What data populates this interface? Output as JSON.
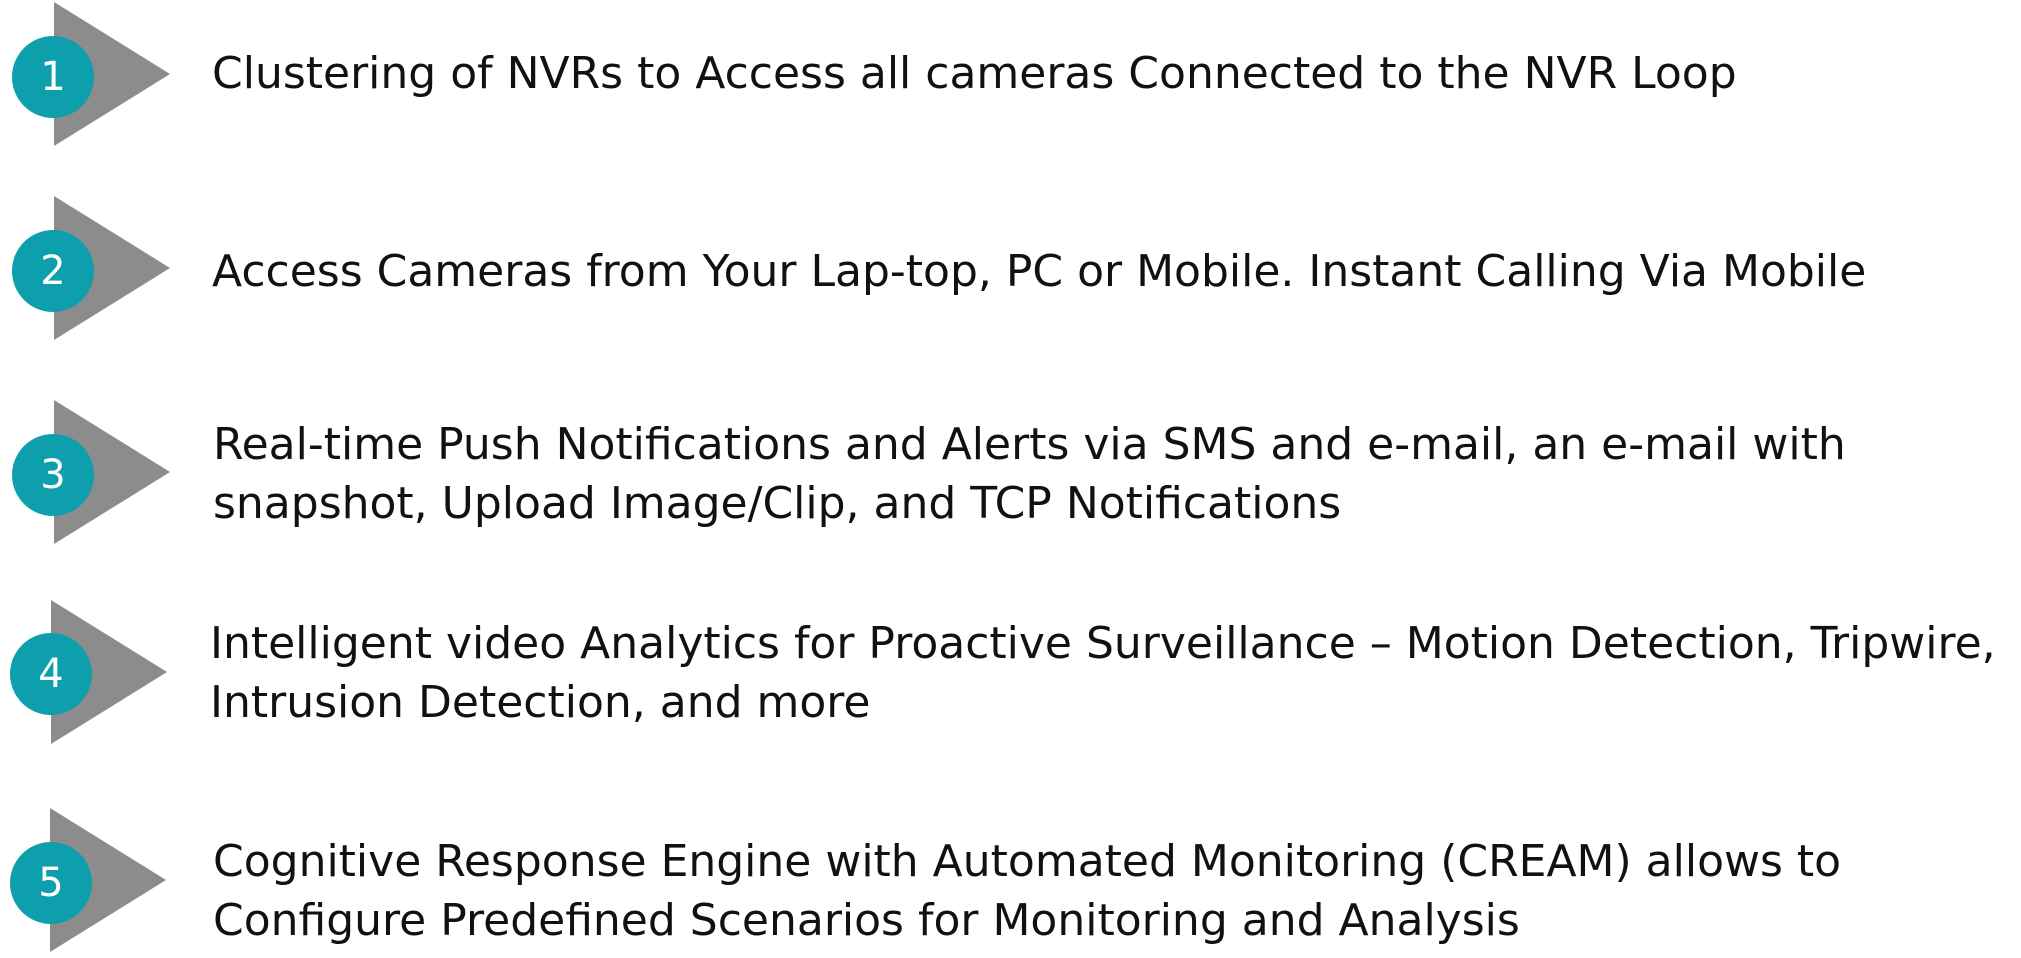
{
  "colors": {
    "circle": "#0e9fad",
    "triangle": "#8c8c8c",
    "text": "#111111",
    "number": "#ffffff"
  },
  "icons": {
    "triangle": "play-triangle-icon",
    "circle": "numbered-circle-badge"
  },
  "items": [
    {
      "number": "1",
      "lines": [
        "Clustering of NVRs to Access all cameras Connected to the NVR Loop"
      ]
    },
    {
      "number": "2",
      "lines": [
        "Access Cameras from Your Lap-top, PC or Mobile. Instant Calling Via Mobile"
      ]
    },
    {
      "number": "3",
      "lines": [
        "Real-time Push Notifications and Alerts via SMS and e-mail, an e-mail with",
        "snapshot, Upload Image/Clip, and TCP Notifications"
      ]
    },
    {
      "number": "4",
      "lines": [
        "Intelligent video Analytics for Proactive Surveillance – Motion Detection, Tripwire,",
        "Intrusion Detection, and more"
      ]
    },
    {
      "number": "5",
      "lines": [
        "Cognitive Response Engine with Automated Monitoring (CREAM) allows to",
        "Configure Predefined Scenarios for Monitoring and Analysis"
      ]
    }
  ]
}
